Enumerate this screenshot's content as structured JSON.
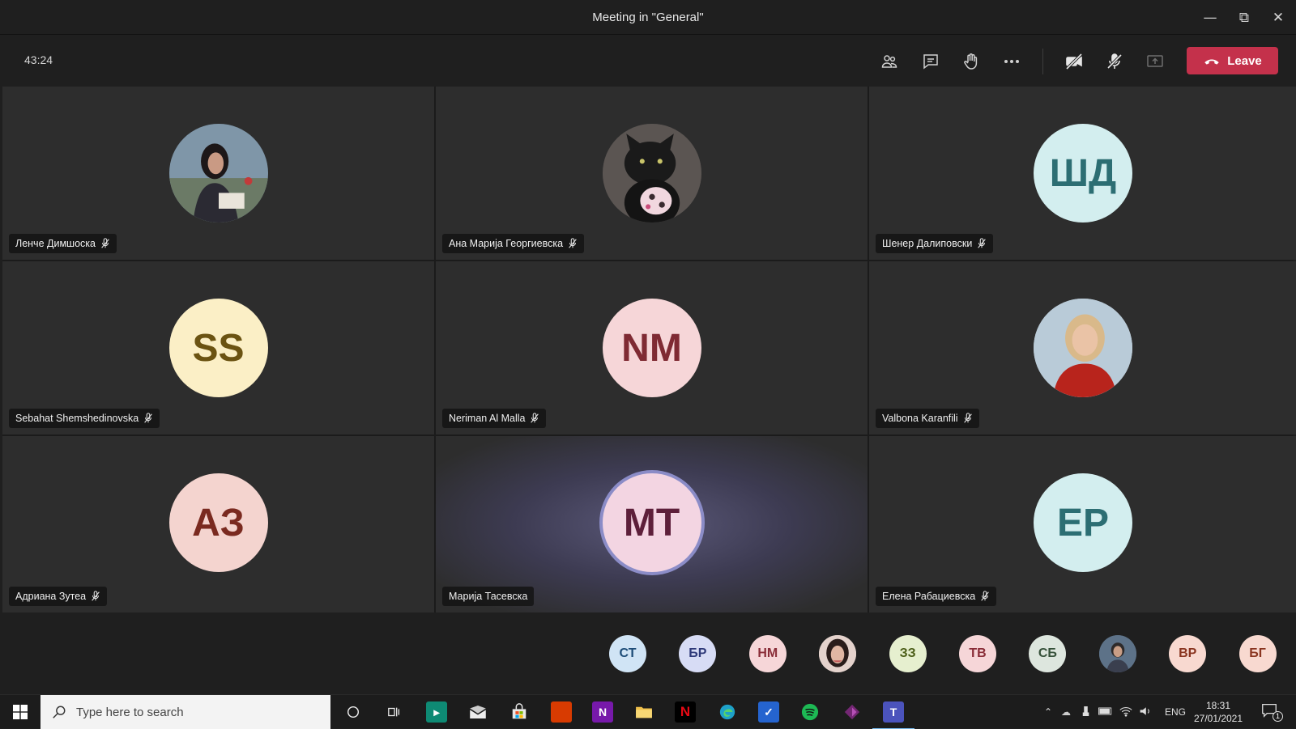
{
  "window": {
    "title": "Meeting in \"General\""
  },
  "toolbar": {
    "timer": "43:24",
    "leave_label": "Leave",
    "leave_color": "#c4314b"
  },
  "participants": [
    {
      "name": "Ленче Димшоска",
      "initials": "",
      "photo": "woman-dark-hair-photo",
      "bg": "#3a4a55",
      "fg": "#ffffff",
      "muted": true
    },
    {
      "name": "Ана Марија Георгиевска",
      "initials": "",
      "photo": "black-cat-photo",
      "bg": "#444444",
      "fg": "#ffffff",
      "muted": true
    },
    {
      "name": "Шенер Далиповски",
      "initials": "ШД",
      "photo": "",
      "bg": "#d3eeef",
      "fg": "#2c6e73",
      "muted": true
    },
    {
      "name": "Sebahat Shemshedinovska",
      "initials": "SS",
      "photo": "",
      "bg": "#fbefc6",
      "fg": "#6b5312",
      "muted": true
    },
    {
      "name": "Neriman Al Malla",
      "initials": "NM",
      "photo": "",
      "bg": "#f6d6d8",
      "fg": "#7f2a33",
      "muted": true
    },
    {
      "name": "Valbona Karanfili",
      "initials": "",
      "photo": "woman-blonde-red-top-photo",
      "bg": "#cfd9e2",
      "fg": "#ffffff",
      "muted": true
    },
    {
      "name": "Адриана Зутеа",
      "initials": "АЗ",
      "photo": "",
      "bg": "#f4d4cf",
      "fg": "#7a2a20",
      "muted": true
    },
    {
      "name": "Марија Тасевска",
      "initials": "МТ",
      "photo": "",
      "bg": "#f3d5e2",
      "fg": "#5d1f3a",
      "muted": false,
      "speaking": true
    },
    {
      "name": "Елена Рабациевска",
      "initials": "ЕР",
      "photo": "",
      "bg": "#d3eeef",
      "fg": "#2c6e73",
      "muted": true
    }
  ],
  "overflow": [
    {
      "initials": "СТ",
      "bg": "#d0e4f5",
      "fg": "#1e4d78"
    },
    {
      "initials": "БР",
      "bg": "#d7dcf5",
      "fg": "#2f3a7a"
    },
    {
      "initials": "НМ",
      "bg": "#f6d6d8",
      "fg": "#8a2d38"
    },
    {
      "initials": "",
      "photo": "woman-portrait-photo",
      "bg": "#d8c8c2",
      "fg": "#ffffff"
    },
    {
      "initials": "ЗЗ",
      "bg": "#e6efcf",
      "fg": "#4a5c16"
    },
    {
      "initials": "ТВ",
      "bg": "#f6d6d8",
      "fg": "#8a2d38"
    },
    {
      "initials": "СБ",
      "bg": "#dde6de",
      "fg": "#36513a"
    },
    {
      "initials": "",
      "photo": "person-outdoor-photo",
      "bg": "#4a5a6a",
      "fg": "#ffffff"
    },
    {
      "initials": "ВР",
      "bg": "#f8d9d0",
      "fg": "#8a3520"
    },
    {
      "initials": "БГ",
      "bg": "#f8d9d0",
      "fg": "#8a3520"
    }
  ],
  "taskbar": {
    "search_placeholder": "Type here to search",
    "lang": "ENG",
    "time": "18:31",
    "date": "27/01/2021",
    "notifications": "1",
    "apps": [
      {
        "name": "cortana-icon"
      },
      {
        "name": "task-view-icon"
      },
      {
        "name": "sway-icon"
      },
      {
        "name": "mail-icon"
      },
      {
        "name": "store-icon"
      },
      {
        "name": "office-icon"
      },
      {
        "name": "onenote-icon"
      },
      {
        "name": "file-explorer-icon"
      },
      {
        "name": "netflix-icon"
      },
      {
        "name": "edge-icon"
      },
      {
        "name": "todo-icon"
      },
      {
        "name": "spotify-icon"
      },
      {
        "name": "power-apps-icon"
      },
      {
        "name": "teams-icon"
      }
    ]
  }
}
